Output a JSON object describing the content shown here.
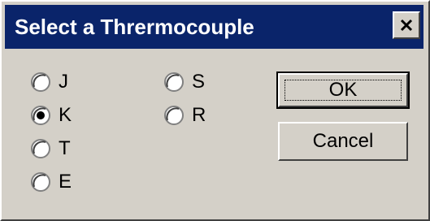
{
  "window": {
    "title": "Select a Thrermocouple"
  },
  "titlebar": {
    "close_icon": "close-icon"
  },
  "radio_options": [
    {
      "label": "J",
      "checked": false
    },
    {
      "label": "K",
      "checked": true
    },
    {
      "label": "T",
      "checked": false
    },
    {
      "label": "E",
      "checked": false
    },
    {
      "label": "S",
      "checked": false
    },
    {
      "label": "R",
      "checked": false
    }
  ],
  "buttons": {
    "ok_label": "OK",
    "cancel_label": "Cancel"
  },
  "colors": {
    "titlebar": "#0a246a",
    "face": "#d4d0c8"
  }
}
